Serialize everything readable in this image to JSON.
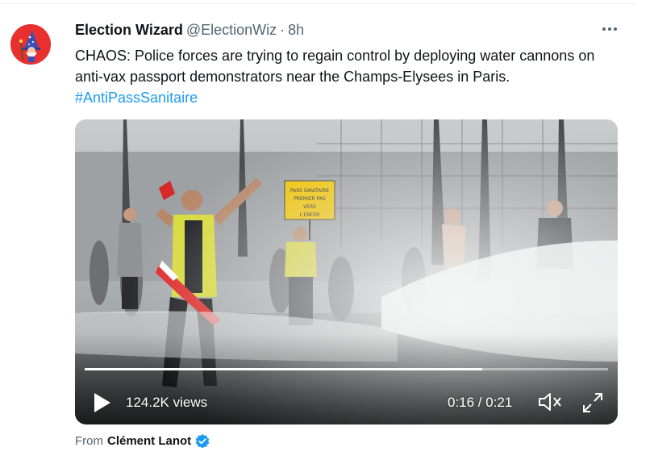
{
  "tweet": {
    "author": {
      "display_name": "Election Wizard",
      "handle": "@ElectionWiz",
      "separator": "·",
      "time": "8h",
      "avatar_icon": "wizard-avatar-icon"
    },
    "more_icon": "more-options-icon",
    "text_main": "CHAOS: Police forces are trying to regain control by deploying water cannons on anti-vax passport demonstrators near the Champs-Elysees in Paris.",
    "hashtag": "#AntiPassSanitaire",
    "sign_text": "PASS SANITAIRE PREMIER PAS VERS L'ENFER"
  },
  "video": {
    "views": "124.2K views",
    "timecode": "0:16 / 0:21",
    "progress": 0.76,
    "play_icon": "play-icon",
    "mute_icon": "muted-speaker-icon",
    "expand_icon": "expand-icon"
  },
  "attribution": {
    "from_label": "From",
    "source_name": "Clément Lanot",
    "verified_icon": "verified-badge-icon"
  },
  "colors": {
    "link": "#1d9bf0",
    "secondary_text": "#536471",
    "avatar_bg": "#e8312f",
    "verified": "#1d9bf0"
  }
}
